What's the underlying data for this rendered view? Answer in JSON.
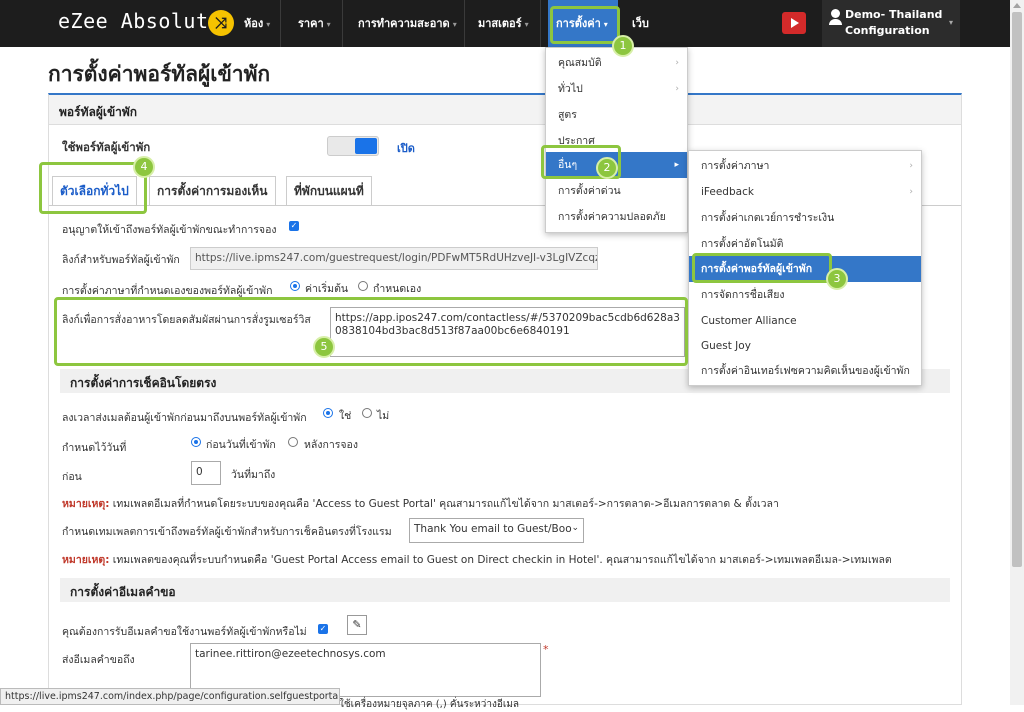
{
  "topbar": {
    "logo": "eZee Absolute",
    "logo_icon": "shuffle-icon",
    "nav": [
      {
        "label": "ห้อง"
      },
      {
        "label": "ราคา"
      },
      {
        "label": "การทำความสะอาด"
      },
      {
        "label": "มาสเตอร์"
      },
      {
        "label": "การตั้งค่า"
      },
      {
        "label": "เว็บ"
      }
    ],
    "user_name": "Demo- Thailand",
    "user_sub": "Configuration"
  },
  "page": {
    "title": "การตั้งค่าพอร์ทัลผู้เข้าพัก",
    "panel_heading": "พอร์ทัลผู้เข้าพัก",
    "use_portal_label": "ใช้พอร์ทัลผู้เข้าพัก",
    "toggle_state": "เปิด",
    "tabs": [
      "ตัวเลือกทั่วไป",
      "การตั้งค่าการมองเห็น",
      "ที่พักบนแผนที่"
    ]
  },
  "form": {
    "allow_label": "อนุญาตให้เข้าถึงพอร์ทัลผู้เข้าพักขณะทำการจอง",
    "link_label": "ลิงก์สำหรับพอร์ทัลผู้เข้าพัก",
    "link_value": "https://live.ipms247.com/guestrequest/login/PDFwMT5RdUHzveJI-v3LgIVZcqzm",
    "lang_label": "การตั้งค่าภาษาที่กำหนดเองของพอร์ทัลผู้เข้าพัก",
    "lang_opt1": "ค่าเริ่มต้น",
    "lang_opt2": "กำหนดเอง",
    "contactless_label": "ลิงก์เพื่อการสั่งอาหารโดยลดสัมผัสผ่านการสั่งรูมเซอร์วิส",
    "contactless_value": "https://app.ipos247.com/contactless/#/5370209bac5cdb6d628a30838104bd3bac8d513f87aa00bc6e6840191"
  },
  "checkin": {
    "heading": "การตั้งค่าการเช็คอินโดยตรง",
    "reminder_label": "ลงเวลาส่งเมลต้อนผู้เข้าพักก่อนมาถึงบนพอร์ทัลผู้เข้าพัก",
    "yes": "ใช่",
    "no": "ไม่",
    "schedule_label": "กำหนดไว้วันที่",
    "before_arrival": "ก่อนวันที่เข้าพัก",
    "after_booking": "หลังการจอง",
    "before_label": "ก่อน",
    "days_value": "0",
    "days_unit": "วันที่มาถึง",
    "note_prefix": "หมายเหตุ:",
    "note1": " เทมเพลตอีเมลที่กำหนดโดยระบบของคุณคือ 'Access to Guest Portal' คุณสามารถแก้ไขได้จาก มาสเตอร์->การตลาด->อีเมลการตลาด & ตั้งเวลา",
    "template_label": "กำหนดเทมเพลตการเข้าถึงพอร์ทัลผู้เข้าพักสำหรับการเช็คอินตรงที่โรงแรม",
    "template_value": "Thank You email to Guest/Boo",
    "note2": " เทมเพลตของคุณที่ระบบกำหนดคือ 'Guest Portal Access email to Guest on Direct checkin in Hotel'. คุณสามารถแก้ไขได้จาก มาสเตอร์->เทมเพลตอีเมล->เทมเพลต"
  },
  "email": {
    "heading": "การตั้งค่าอีเมลคำขอ",
    "want_label": "คุณต้องการรับอีเมลคำขอใช้งานพอร์ทัลผู้เข้าพักหรือไม่",
    "send_label": "ส่งอีเมลคำขอถึง",
    "send_value": "tarinee.rittiron@ezeetechnosys.com",
    "required_mark": "*",
    "hint_fragment": "ใช้เครื่องหมายจุลภาค (,) คั่นระหว่างอีเมล"
  },
  "menu_settings": [
    {
      "label": "คุณสมบัติ"
    },
    {
      "label": "ทั่วไป"
    },
    {
      "label": "สูตร"
    },
    {
      "label": "ประกาศ"
    },
    {
      "label": "อื่นๆ"
    },
    {
      "label": "การตั้งค่าด่วน"
    },
    {
      "label": "การตั้งค่าความปลอดภัย"
    }
  ],
  "menu_other": [
    {
      "label": "การตั้งค่าภาษา"
    },
    {
      "label": "iFeedback"
    },
    {
      "label": "การตั้งค่าเกตเวย์การชำระเงิน"
    },
    {
      "label": "การตั้งค่าอัตโนมัติ"
    },
    {
      "label": "การตั้งค่าพอร์ทัลผู้เข้าพัก"
    },
    {
      "label": "การจัดการชื่อเสียง"
    },
    {
      "label": "Customer Alliance"
    },
    {
      "label": "Guest Joy"
    },
    {
      "label": "การตั้งค่าอินเทอร์เฟซความคิดเห็นของผู้เข้าพัก"
    }
  ],
  "badges": [
    "1",
    "2",
    "3",
    "4",
    "5"
  ],
  "status_url": "https://live.ipms247.com/index.php/page/configuration.selfguestportalsettin...",
  "colors": {
    "accent": "#3477c8",
    "highlight": "#8dc63f",
    "note": "#c0392b",
    "topbar": "#1d1d1d"
  }
}
